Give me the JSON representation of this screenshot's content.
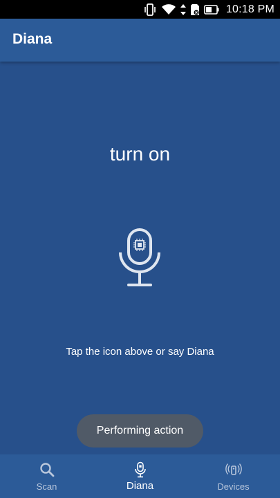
{
  "status_bar": {
    "time": "10:18 PM",
    "icons": [
      "vibrate-icon",
      "wifi-icon",
      "data-arrows-icon",
      "sim-icon",
      "battery-icon"
    ]
  },
  "app_bar": {
    "title": "Diana"
  },
  "main": {
    "heading": "turn on",
    "mic_icon": "microphone-chip-icon",
    "hint": "Tap the icon above or say Diana"
  },
  "toast": {
    "text": "Performing action"
  },
  "bottom_nav": {
    "active": "Diana",
    "items": [
      {
        "label": "Scan",
        "icon": "search-icon"
      },
      {
        "label": "Diana",
        "icon": "microphone-icon"
      },
      {
        "label": "Devices",
        "icon": "device-signal-icon"
      }
    ]
  },
  "colors": {
    "background": "#27508b",
    "app_bar": "#2c5b98",
    "toast": "#505a67",
    "inactive_nav": "#b9c7dc",
    "mic_stroke": "#dfe6f0"
  }
}
